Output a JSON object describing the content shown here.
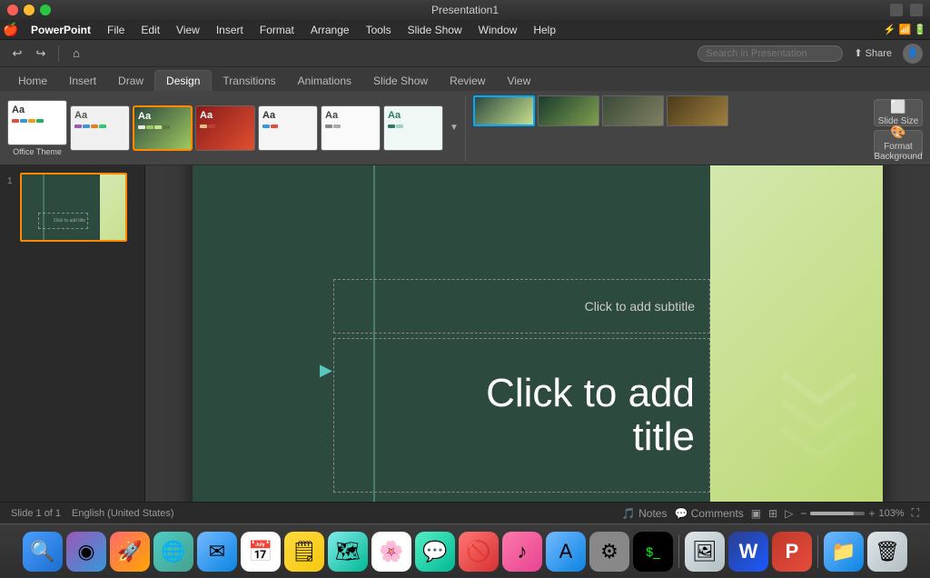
{
  "app": {
    "title": "Presentation1",
    "name": "PowerPoint"
  },
  "title_bar": {
    "buttons": [
      "close",
      "minimize",
      "maximize"
    ]
  },
  "menu_bar": {
    "apple": "🍎",
    "app_name": "PowerPoint",
    "items": [
      "File",
      "Edit",
      "View",
      "Insert",
      "Format",
      "Arrange",
      "Tools",
      "Slide Show",
      "Window",
      "Help"
    ]
  },
  "toolbar": {
    "undo_label": "↩",
    "redo_label": "↪",
    "search_placeholder": "Search in Presentation",
    "share_label": "⬆ Share"
  },
  "ribbon_tabs": {
    "tabs": [
      "Home",
      "Insert",
      "Draw",
      "Design",
      "Transitions",
      "Animations",
      "Slide Show",
      "Review",
      "View"
    ],
    "active_tab": "Design"
  },
  "ribbon": {
    "themes": [
      {
        "id": "t1",
        "label": "Aa",
        "sublabel": "",
        "class": "t1"
      },
      {
        "id": "t2",
        "label": "Aa",
        "sublabel": "",
        "class": "t2"
      },
      {
        "id": "t3",
        "label": "Aa",
        "sublabel": "",
        "class": "t3-active"
      },
      {
        "id": "t4",
        "label": "Aa",
        "sublabel": "",
        "class": "t3"
      },
      {
        "id": "t5",
        "label": "Aa",
        "sublabel": "",
        "class": "t2"
      },
      {
        "id": "t6",
        "label": "Aa",
        "sublabel": "",
        "class": "t1"
      },
      {
        "id": "t7",
        "label": "Aa",
        "sublabel": "",
        "class": "t1"
      }
    ],
    "variants": [
      {
        "id": "sv1",
        "class": "sv1"
      },
      {
        "id": "sv2",
        "class": "sv2"
      },
      {
        "id": "sv3",
        "class": "sv3"
      },
      {
        "id": "sv4",
        "class": "sv4"
      }
    ],
    "slide_size_label": "Slide\nSize",
    "format_bg_label": "Format\nBackground"
  },
  "slide": {
    "number": 1,
    "title_placeholder": "Click to add\ntitle",
    "subtitle_placeholder": "Click to add subtitle",
    "total": 1
  },
  "status_bar": {
    "slide_info": "Slide 1 of 1",
    "language": "English (United States)",
    "notes_label": "Notes",
    "comments_label": "Comments",
    "zoom_percent": "103%"
  },
  "dock": {
    "items": [
      "🔍",
      "◉",
      "🚀",
      "🌐",
      "✉",
      "📅",
      "🗂",
      "🗺",
      "📸",
      "💬",
      "🎵",
      "📱",
      "⚙",
      "⌨",
      "🖥",
      "W",
      "P",
      "📁",
      "🗑"
    ]
  }
}
